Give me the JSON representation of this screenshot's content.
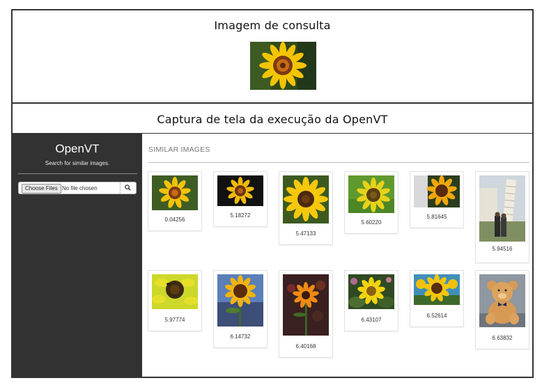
{
  "query_section": {
    "title": "Imagem de consulta",
    "image": "sunflower-query-image"
  },
  "caption_section": {
    "title": "Captura de tela da execução da OpenVT"
  },
  "sidebar": {
    "brand": "OpenVT",
    "tagline": "Search for similar images.",
    "upload": {
      "button_label": "Choose Files",
      "status": "No file chosen",
      "search_icon": "search-icon"
    }
  },
  "main": {
    "header": "SIMILAR IMAGES",
    "results": [
      {
        "score": "0.04256",
        "image": "sunflower"
      },
      {
        "score": "5.18272",
        "image": "sunflower-dark-background"
      },
      {
        "score": "5.47133",
        "image": "sunflower-closeup"
      },
      {
        "score": "5.60220",
        "image": "sunflower-green-background"
      },
      {
        "score": "5.81645",
        "image": "sunflower-leaning"
      },
      {
        "score": "5.94516",
        "image": "leaning-tower-of-pisa-photo"
      },
      {
        "score": "5.97774",
        "image": "sunflower-with-bee"
      },
      {
        "score": "6.14732",
        "image": "sunflower-against-sky"
      },
      {
        "score": "6.40168",
        "image": "orange-flower-dark-background"
      },
      {
        "score": "6.43107",
        "image": "sunflower-in-garden"
      },
      {
        "score": "6.52614",
        "image": "sunflower-blue-sky"
      },
      {
        "score": "6.63832",
        "image": "teddy-bear"
      }
    ]
  },
  "colors": {
    "sidebar_bg": "#323232",
    "border": "#333333",
    "header_text": "#777777"
  }
}
